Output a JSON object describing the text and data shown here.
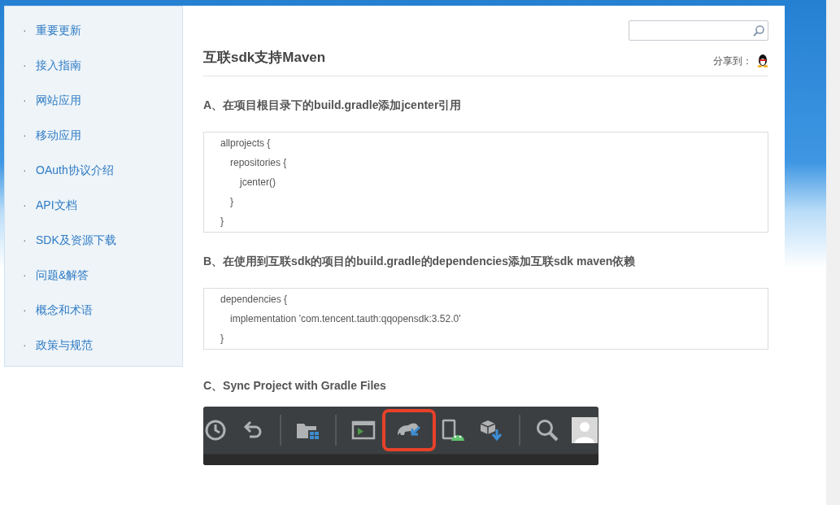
{
  "sidebar": {
    "items": [
      {
        "bullet": "·",
        "label": "重要更新"
      },
      {
        "bullet": "·",
        "label": "接入指南"
      },
      {
        "bullet": "·",
        "label": "网站应用"
      },
      {
        "bullet": "·",
        "label": "移动应用"
      },
      {
        "bullet": "·",
        "label": "OAuth协议介绍"
      },
      {
        "bullet": "·",
        "label": "API文档"
      },
      {
        "bullet": "·",
        "label": "SDK及资源下载"
      },
      {
        "bullet": "·",
        "label": "问题&解答"
      },
      {
        "bullet": "·",
        "label": "概念和术语"
      },
      {
        "bullet": "·",
        "label": "政策与规范"
      }
    ]
  },
  "article": {
    "title": "互联sdk支持Maven",
    "share_label": "分享到：",
    "sections": [
      {
        "heading": "A、在项目根目录下的build.gradle添加jcenter引用",
        "code": [
          {
            "text": "allprojects {",
            "children": [
              {
                "text": "repositories {",
                "children": [
                  {
                    "text": "jcenter()"
                  }
                ]
              },
              {
                "text": "}"
              }
            ]
          },
          {
            "text": "}"
          }
        ]
      },
      {
        "heading": "B、在使用到互联sdk的项目的build.gradle的dependencies添加互联sdk maven依赖",
        "code": [
          {
            "text": "dependencies {",
            "children": [
              {
                "text": "implementation 'com.tencent.tauth:qqopensdk:3.52.0'"
              }
            ]
          },
          {
            "text": "}"
          }
        ]
      },
      {
        "heading": "C、Sync Project with Gradle Files",
        "toolbar": [
          {
            "kind": "clock",
            "highlighted": false
          },
          {
            "kind": "undo",
            "highlighted": false
          },
          {
            "kind": "separator"
          },
          {
            "kind": "folder",
            "highlighted": false
          },
          {
            "kind": "separator"
          },
          {
            "kind": "terminal",
            "highlighted": false
          },
          {
            "kind": "elephant",
            "highlighted": true
          },
          {
            "kind": "device",
            "highlighted": false
          },
          {
            "kind": "cube",
            "highlighted": false
          },
          {
            "kind": "separator"
          },
          {
            "kind": "search",
            "highlighted": false
          },
          {
            "kind": "avatar",
            "highlighted": false
          }
        ]
      }
    ]
  }
}
